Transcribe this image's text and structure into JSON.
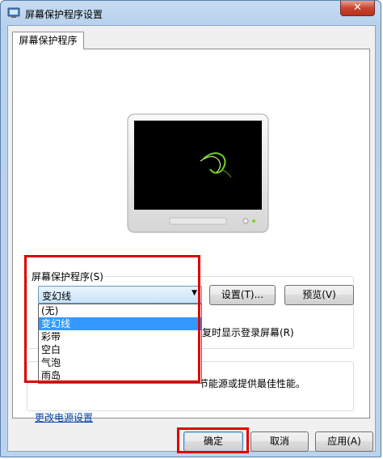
{
  "window": {
    "title": "屏幕保护程序设置",
    "close_label": "✕"
  },
  "tab": {
    "label": "屏幕保护程序"
  },
  "screensaver": {
    "group_label": "屏幕保护程序(S)",
    "selected": "变幻线",
    "options": [
      "(无)",
      "变幻线",
      "彩带",
      "空白",
      "气泡",
      "雨岛"
    ],
    "settings_button": "设置(T)...",
    "preview_button": "预览(V)",
    "resume_text": "恢复时显示登录屏幕(R)"
  },
  "power": {
    "partial_text": "节能源或提供最佳性能。",
    "link": "更改电源设置"
  },
  "footer": {
    "ok_button": "确定",
    "cancel_button": "取消",
    "apply_button": "应用(A)"
  },
  "colors": {
    "highlight": "#3399ff",
    "annotation_red": "#e00000"
  }
}
